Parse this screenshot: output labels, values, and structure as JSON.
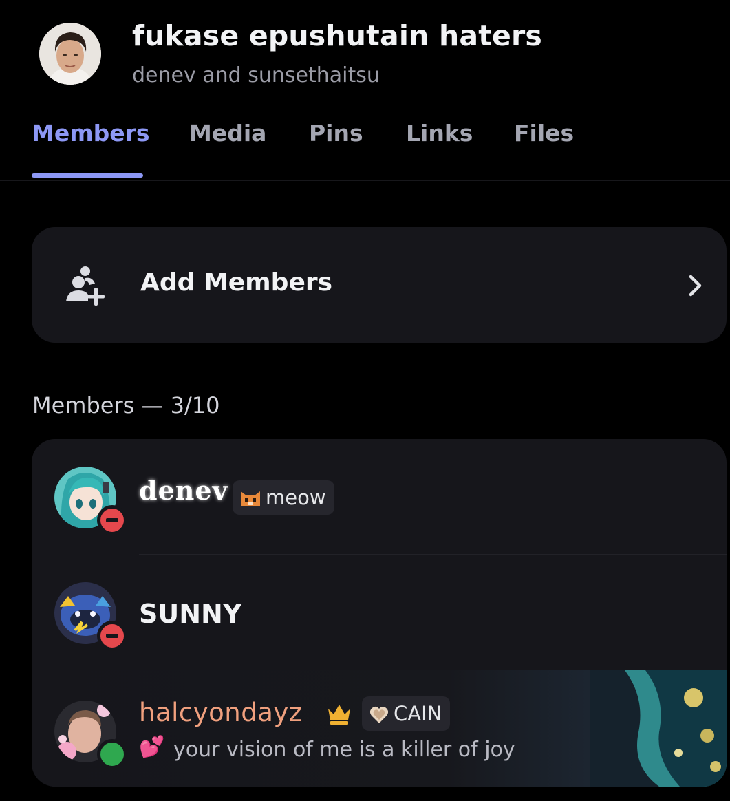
{
  "header": {
    "title": "fukase epushutain haters",
    "subtitle": "denev and sunsethaitsu"
  },
  "tabs": [
    {
      "label": "Members",
      "active": true
    },
    {
      "label": "Media",
      "active": false
    },
    {
      "label": "Pins",
      "active": false
    },
    {
      "label": "Links",
      "active": false
    },
    {
      "label": "Files",
      "active": false
    }
  ],
  "add_members": {
    "label": "Add Members",
    "icon": "add-user-icon",
    "chevron": "chevron-right-icon"
  },
  "members_section": {
    "heading": "Members — 3/10"
  },
  "members": [
    {
      "name": "denev",
      "status": "do-not-disturb",
      "tag": {
        "icon": "cat-emoji",
        "label": "meow"
      }
    },
    {
      "name": "SUNNY",
      "status": "do-not-disturb"
    },
    {
      "name": "halcyondayz",
      "status": "online",
      "owner_icon": "crown-icon",
      "tag": {
        "icon": "heart-shield-icon",
        "label": "CAIN"
      },
      "custom_status": {
        "emoji": "💕",
        "text": "your vision of me is a killer of joy"
      }
    }
  ],
  "colors": {
    "accent": "#8d98f5",
    "card_bg": "#16161b",
    "background": "#000000",
    "dnd": "#e5484d",
    "online": "#2fa84f",
    "crown": "#f0b132",
    "halcyon_name": "#f0a07e"
  }
}
